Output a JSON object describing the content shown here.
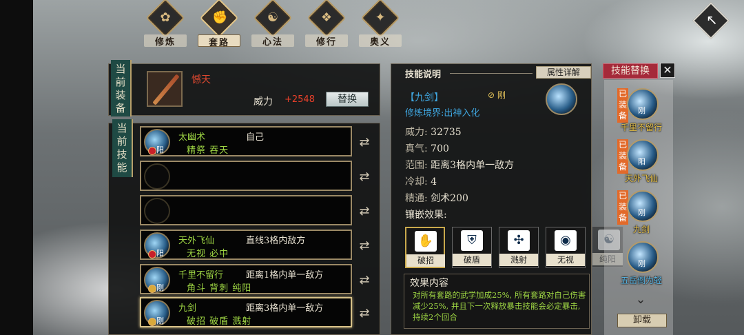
{
  "tabs": [
    {
      "label": "修炼",
      "icon": "lotus-icon"
    },
    {
      "label": "套路",
      "icon": "fist-icon"
    },
    {
      "label": "心法",
      "icon": "yinyang-icon"
    },
    {
      "label": "修行",
      "icon": "book-icon"
    },
    {
      "label": "奥义",
      "icon": "scroll-icon"
    }
  ],
  "equip": {
    "section_label": "当前装备",
    "name": "憾天",
    "power_label": "威力",
    "power_value": "+2548",
    "replace_label": "替换"
  },
  "skills": {
    "section_label": "当前技能",
    "slots": [
      {
        "name": "太幽术",
        "sub": "精祭 吞天",
        "range": "自己",
        "tag": "阳",
        "empty": false
      },
      {
        "name": "",
        "sub": "",
        "range": "",
        "tag": "",
        "empty": true
      },
      {
        "name": "",
        "sub": "",
        "range": "",
        "tag": "",
        "empty": true
      },
      {
        "name": "天外飞仙",
        "sub": "无视 必中",
        "range": "直线3格内敌方",
        "tag": "阳",
        "empty": false
      },
      {
        "name": "千里不留行",
        "sub": "角斗 背刺 纯阳",
        "range": "距离1格内单一敌方",
        "tag": "刚",
        "empty": false
      },
      {
        "name": "九剑",
        "sub": "破招 破盾 溅射",
        "range": "距离3格内单一敌方",
        "tag": "刚",
        "empty": false
      }
    ]
  },
  "info": {
    "title": "技能说明",
    "attr_button": "属性详解",
    "skill_name": "【九剑】",
    "realm": "修炼境界:出神入化",
    "tag": "刚",
    "stats": [
      {
        "k": "威力:",
        "v": "32735"
      },
      {
        "k": "真气:",
        "v": "700"
      },
      {
        "k": "范围:",
        "v": "距离3格内单一敌方"
      },
      {
        "k": "冷却:",
        "v": "4"
      },
      {
        "k": "精通:",
        "v": "剑术200"
      }
    ],
    "inlay_label": "镶嵌效果:",
    "inlays": [
      {
        "label": "破招",
        "icon": "fist-break-icon"
      },
      {
        "label": "破盾",
        "icon": "shield-icon"
      },
      {
        "label": "溅射",
        "icon": "splash-icon"
      },
      {
        "label": "无视",
        "icon": "eye-icon"
      },
      {
        "label": "纯阳",
        "icon": "yinyang-icon"
      }
    ],
    "effect_title": "效果内容",
    "effect_text": "对所有套路的武学加成25%, 所有套路对自己伤害减少25%, 并且下一次释放暴击技能会必定暴击, 持续2个回合"
  },
  "replace": {
    "title": "技能替换",
    "equipped_label": "已装备",
    "items": [
      {
        "name": "千里不留行",
        "tag": "刚",
        "equipped": true
      },
      {
        "name": "天外飞仙",
        "tag": "阳",
        "equipped": true
      },
      {
        "name": "九剑",
        "tag": "刚",
        "equipped": true
      },
      {
        "name": "五岳倒为轻",
        "tag": "刚",
        "equipped": false
      }
    ],
    "unload_label": "卸载"
  }
}
